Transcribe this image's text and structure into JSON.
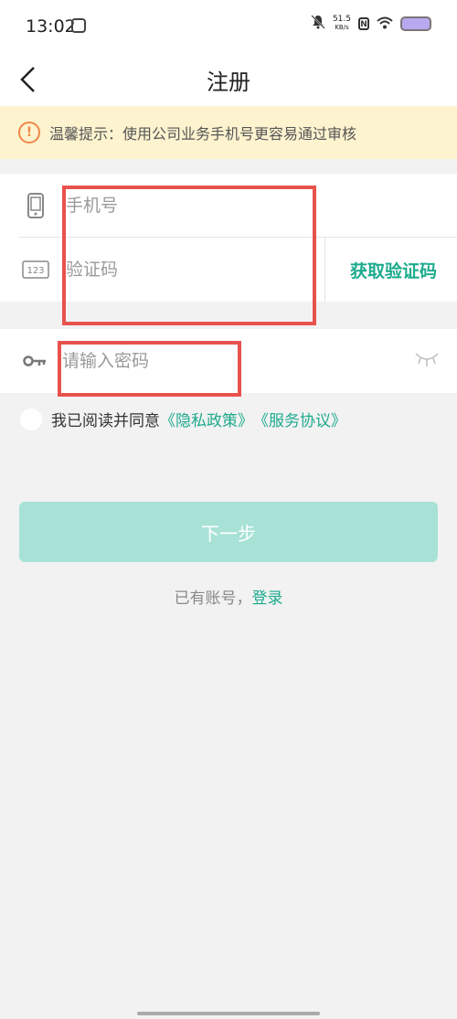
{
  "status_bar": {
    "time": "13:02",
    "net_speed_value": "51.5",
    "net_speed_unit": "KB/s",
    "nfc_label": "N"
  },
  "nav": {
    "title": "注册"
  },
  "notice": {
    "text": "温馨提示：使用公司业务手机号更容易通过审核",
    "icon_color": "#f0884a"
  },
  "form": {
    "phone_placeholder": "手机号",
    "code_placeholder": "验证码",
    "get_code_label": "获取验证码",
    "password_placeholder": "请输入密码"
  },
  "agreement": {
    "prefix": "我已阅读并同意",
    "privacy_link": "《隐私政策》",
    "service_link": "《服务协议》"
  },
  "next_button": {
    "label": "下一步"
  },
  "login_prompt": {
    "text": "已有账号，",
    "link": "登录"
  },
  "colors": {
    "accent": "#1eab8d",
    "button_disabled": "#a8e2d7",
    "annotation": "#e8524d",
    "notice_bg": "#fdf3cf"
  },
  "icons": [
    "back-icon",
    "info-icon",
    "phone-icon",
    "number-123-icon",
    "key-icon",
    "eye-closed-icon",
    "bell-mute-icon",
    "wifi-icon",
    "battery-icon"
  ]
}
